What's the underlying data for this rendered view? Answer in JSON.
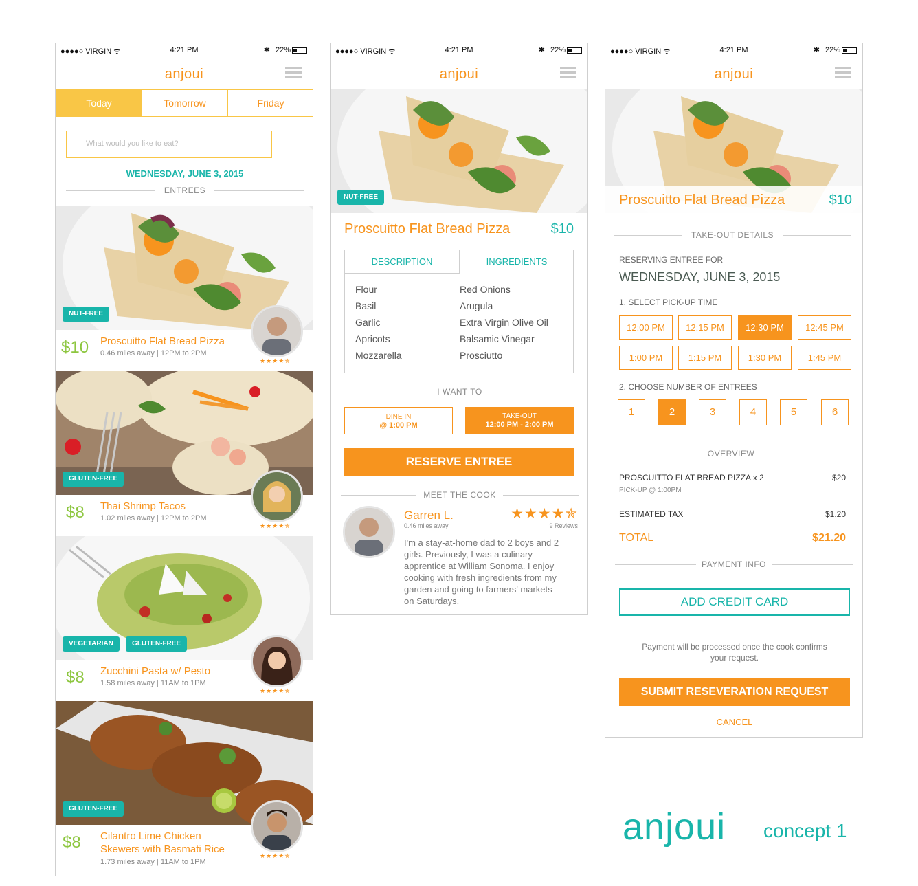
{
  "status_bar": {
    "carrier": "●●●●○ VIRGIN ᯤ",
    "time": "4:21 PM",
    "bluetooth": "✱",
    "battery": "22%"
  },
  "app": {
    "logo": "anjoui"
  },
  "screen1": {
    "tabs": [
      {
        "label": "Today",
        "active": true
      },
      {
        "label": "Tomorrow",
        "active": false
      },
      {
        "label": "Friday",
        "active": false
      }
    ],
    "search_placeholder": "What would you like to eat?",
    "date": "WEDNESDAY, JUNE 3, 2015",
    "section_label": "ENTREES",
    "rating_stars": "★★★★✯",
    "entrees": [
      {
        "price": "$10",
        "title": "Proscuitto Flat Bread Pizza",
        "title2": "",
        "meta": "0.46 miles away | 12PM to 2PM",
        "tags": [
          "NUT-FREE"
        ]
      },
      {
        "price": "$8",
        "title": "Thai Shrimp Tacos",
        "title2": "",
        "meta": "1.02 miles away | 12PM to 2PM",
        "tags": [
          "GLUTEN-FREE"
        ]
      },
      {
        "price": "$8",
        "title": "Zucchini Pasta w/ Pesto",
        "title2": "",
        "meta": "1.58 miles away | 11AM to 1PM",
        "tags": [
          "VEGETARIAN",
          "GLUTEN-FREE"
        ]
      },
      {
        "price": "$8",
        "title": "Cilantro Lime Chicken",
        "title2": "Skewers with Basmati Rice",
        "meta": "1.73 miles away | 11AM to 1PM",
        "tags": [
          "GLUTEN-FREE"
        ]
      }
    ]
  },
  "screen2": {
    "tag": "NUT-FREE",
    "title": "Proscuitto Flat Bread Pizza",
    "price": "$10",
    "tab_description": "DESCRIPTION",
    "tab_ingredients": "INGREDIENTS",
    "ingredients_left": [
      "Flour",
      "Basil",
      "Garlic",
      "Apricots",
      "Mozzarella"
    ],
    "ingredients_right": [
      "Red Onions",
      "Arugula",
      "Extra Virgin Olive Oil",
      "Balsamic Vinegar",
      "Prosciutto"
    ],
    "want_label": "I WANT TO",
    "dine_in_1": "DINE IN",
    "dine_in_2": "@ 1:00 PM",
    "takeout_1": "TAKE-OUT",
    "takeout_2": "12:00 PM - 2:00 PM",
    "reserve_button": "RESERVE ENTREE",
    "meet_label": "MEET THE COOK",
    "cook": {
      "name": "Garren L.",
      "distance": "0.46 miles away",
      "stars": "★★★★✯",
      "reviews": "9 Reviews",
      "bio_lines": [
        "I'm a stay-at-home dad to 2 boys and 2",
        "girls. Previously, I was a culinary",
        "apprentice at William Sonoma.   I enjoy",
        "cooking with fresh ingredients from my",
        "garden and going to farmers' markets",
        "on Saturdays."
      ]
    }
  },
  "screen3": {
    "title": "Proscuitto Flat Bread Pizza",
    "price": "$10",
    "takeout_label": "TAKE-OUT DETAILS",
    "reserving_label": "RESERVING ENTREE FOR",
    "reserving_date": "WEDNESDAY, JUNE 3, 2015",
    "pickup_label": "1. SELECT PICK-UP TIME",
    "times": [
      {
        "label": "12:00 PM",
        "selected": false
      },
      {
        "label": "12:15 PM",
        "selected": false
      },
      {
        "label": "12:30 PM",
        "selected": true
      },
      {
        "label": "12:45 PM",
        "selected": false
      },
      {
        "label": "1:00 PM",
        "selected": false
      },
      {
        "label": "1:15 PM",
        "selected": false
      },
      {
        "label": "1:30 PM",
        "selected": false
      },
      {
        "label": "1:45 PM",
        "selected": false
      }
    ],
    "number_label": "2. CHOOSE NUMBER OF ENTREES",
    "numbers": [
      {
        "label": "1",
        "selected": false
      },
      {
        "label": "2",
        "selected": true
      },
      {
        "label": "3",
        "selected": false
      },
      {
        "label": "4",
        "selected": false
      },
      {
        "label": "5",
        "selected": false
      },
      {
        "label": "6",
        "selected": false
      }
    ],
    "overview_label": "OVERVIEW",
    "line_item": "PROSCUITTO FLAT BREAD PIZZA x 2",
    "line_item_price": "$20",
    "pickup_note": "PICK-UP @ 1:00PM",
    "tax_label": "ESTIMATED TAX",
    "tax_value": "$1.20",
    "total_label": "TOTAL",
    "total_value": "$21.20",
    "payment_label": "PAYMENT INFO",
    "add_card": "ADD CREDIT CARD",
    "payment_note_1": "Payment will be processed once the cook confirms",
    "payment_note_2": "your request.",
    "submit": "SUBMIT RESEVERATION REQUEST",
    "cancel": "CANCEL"
  },
  "branding": {
    "logo": "anjoui",
    "concept": "concept 1"
  },
  "colors": {
    "orange": "#f7941e",
    "teal": "#19b5aa",
    "yellow": "#f9c646",
    "green": "#8dc63f"
  }
}
